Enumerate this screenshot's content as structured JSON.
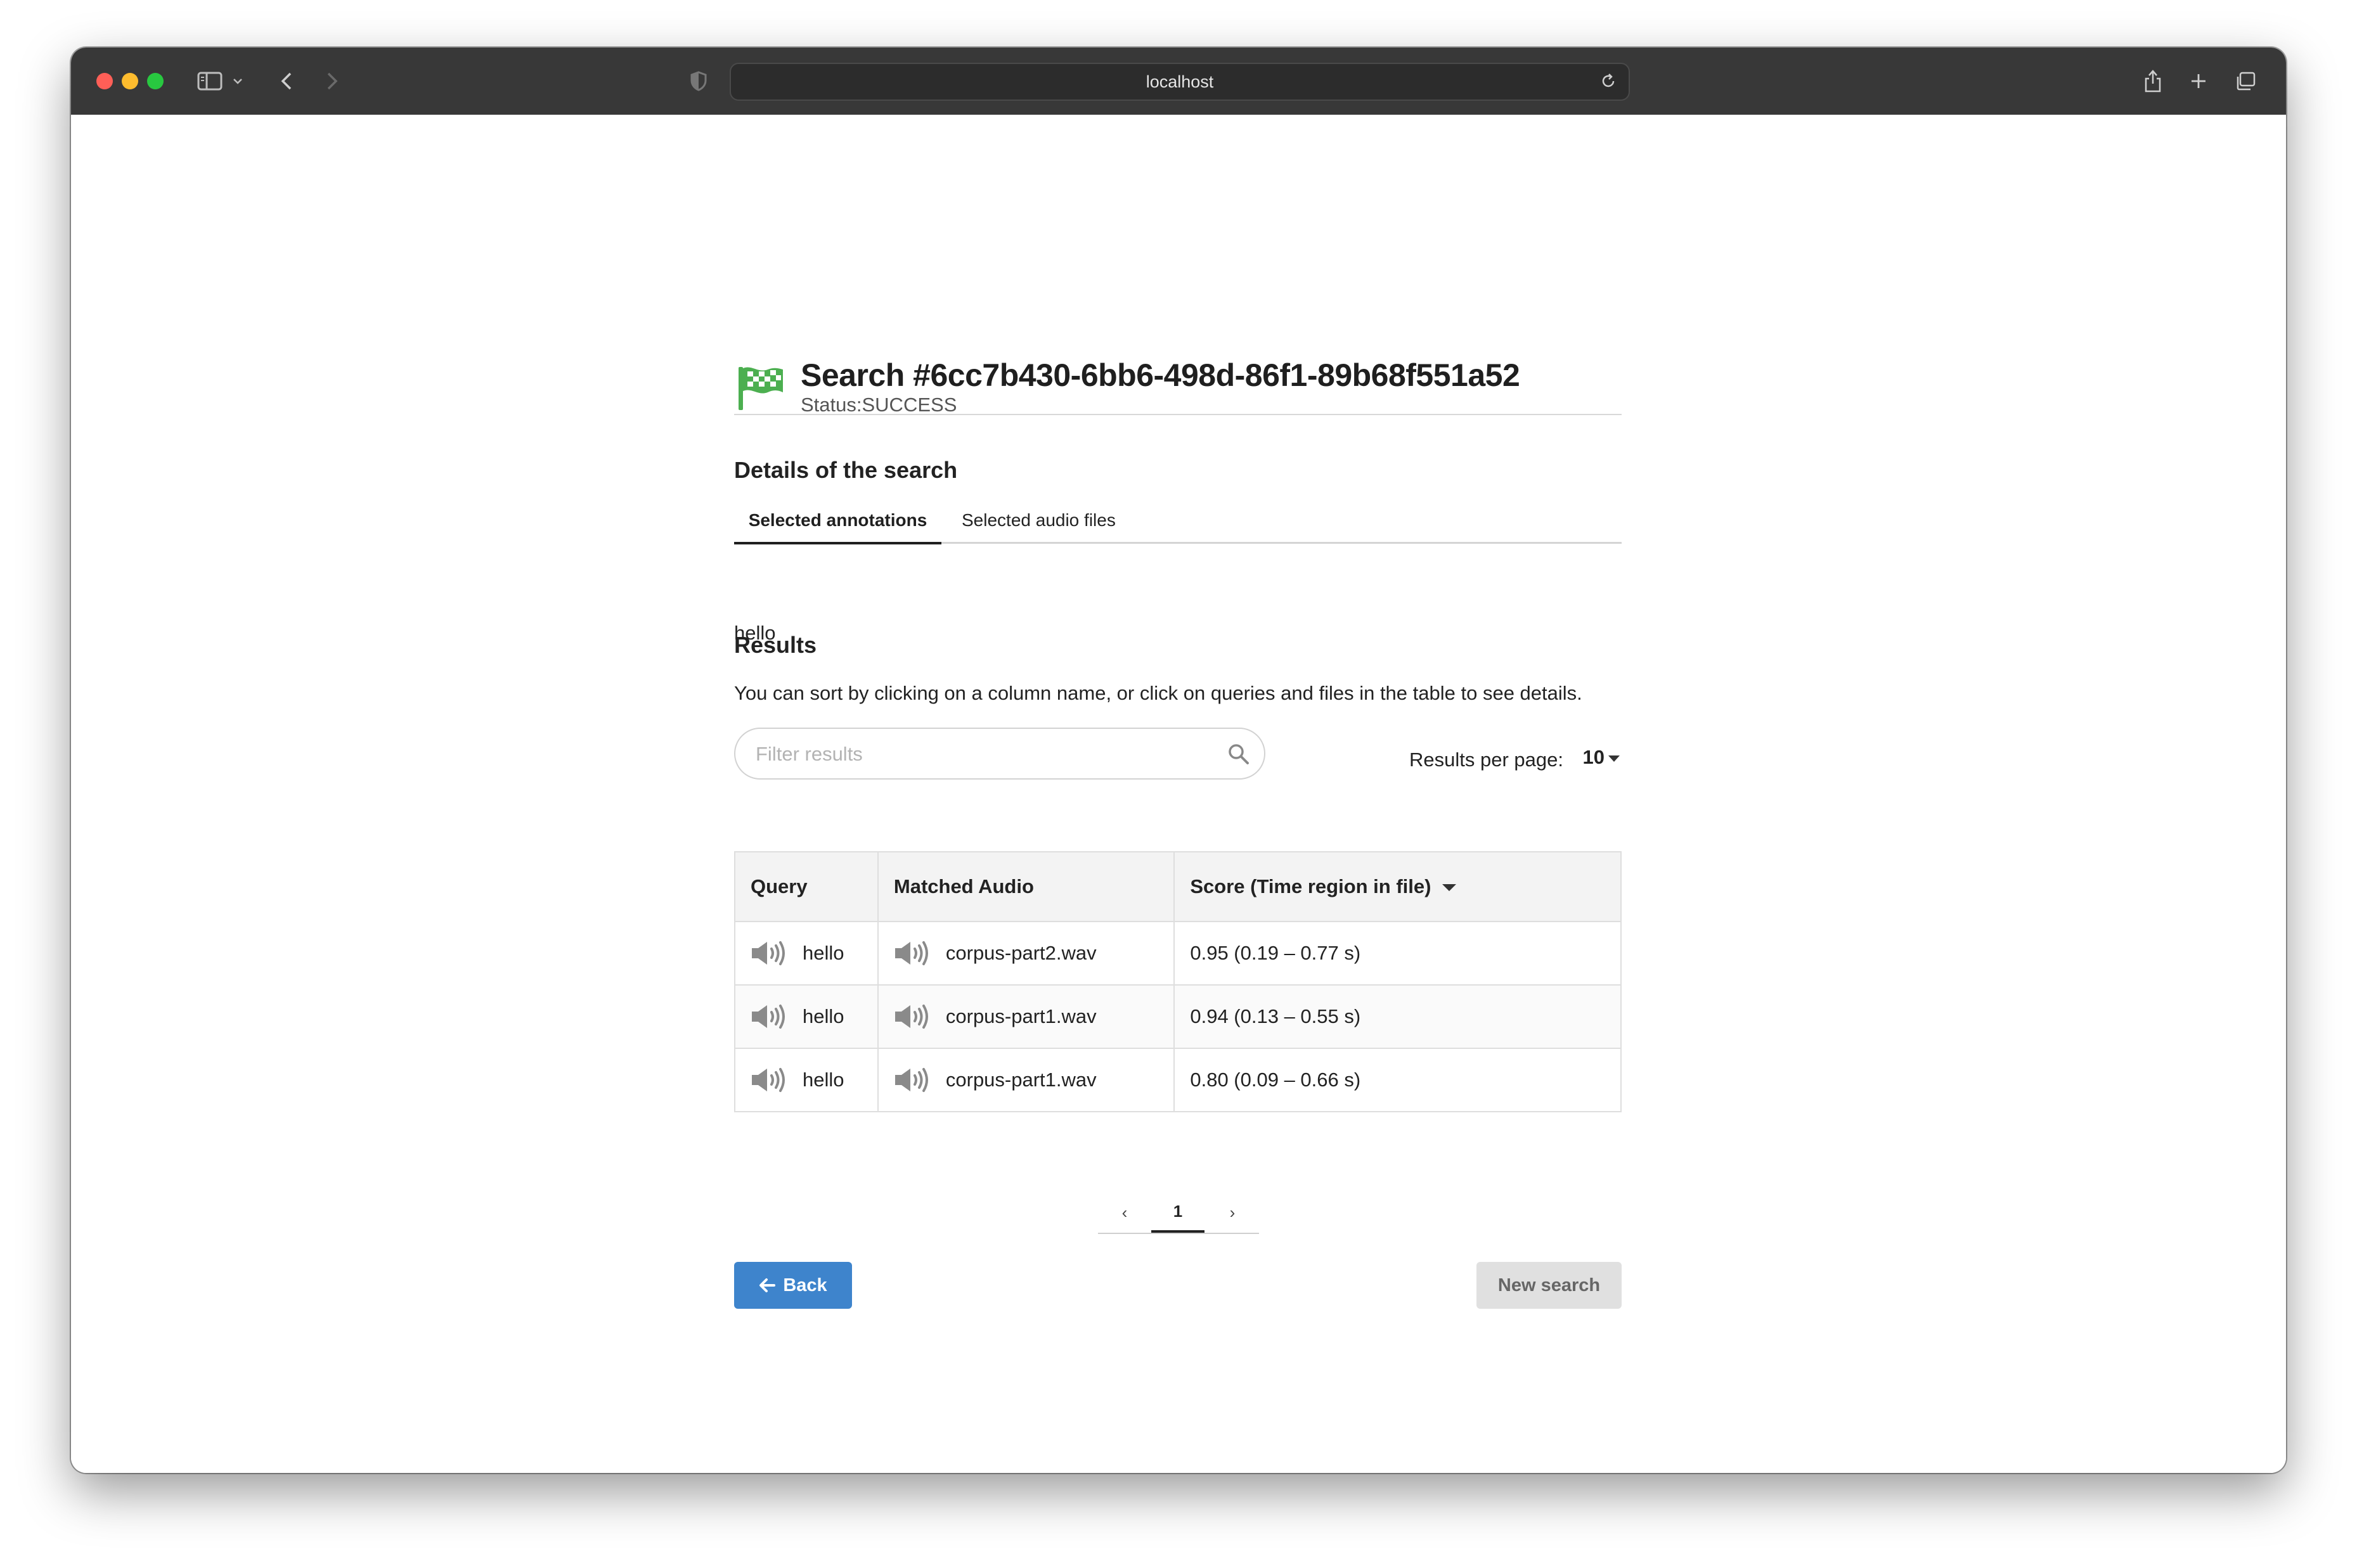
{
  "browser": {
    "url": "localhost"
  },
  "page": {
    "title": "Search #6cc7b430-6bb6-498d-86f1-89b68f551a52",
    "status": "Status:SUCCESS",
    "details_heading": "Details of the search",
    "tabs": [
      {
        "label": "Selected annotations",
        "active": true
      },
      {
        "label": "Selected audio files",
        "active": false
      }
    ],
    "annotation": "hello",
    "results_heading": "Results",
    "results_hint": "You can sort by clicking on a column name, or click on queries and files in the table to see details.",
    "filter_placeholder": "Filter results",
    "results_per_page_label": "Results per page:",
    "results_per_page_value": "10",
    "table": {
      "headers": [
        "Query",
        "Matched Audio",
        "Score (Time region in file)"
      ],
      "rows": [
        {
          "query": "hello",
          "audio": "corpus-part2.wav",
          "score": "0.95 (0.19 – 0.77 s)"
        },
        {
          "query": "hello",
          "audio": "corpus-part1.wav",
          "score": "0.94 (0.13 – 0.55 s)"
        },
        {
          "query": "hello",
          "audio": "corpus-part1.wav",
          "score": "0.80 (0.09 – 0.66 s)"
        }
      ]
    },
    "pagination": {
      "prev": "‹",
      "current": "1",
      "next": "›"
    },
    "back_button": "Back",
    "new_search_button": "New search",
    "colors": {
      "flag_green": "#4caf50",
      "primary_button": "#3e84cc",
      "disabled_button": "#e0e0e0"
    }
  }
}
